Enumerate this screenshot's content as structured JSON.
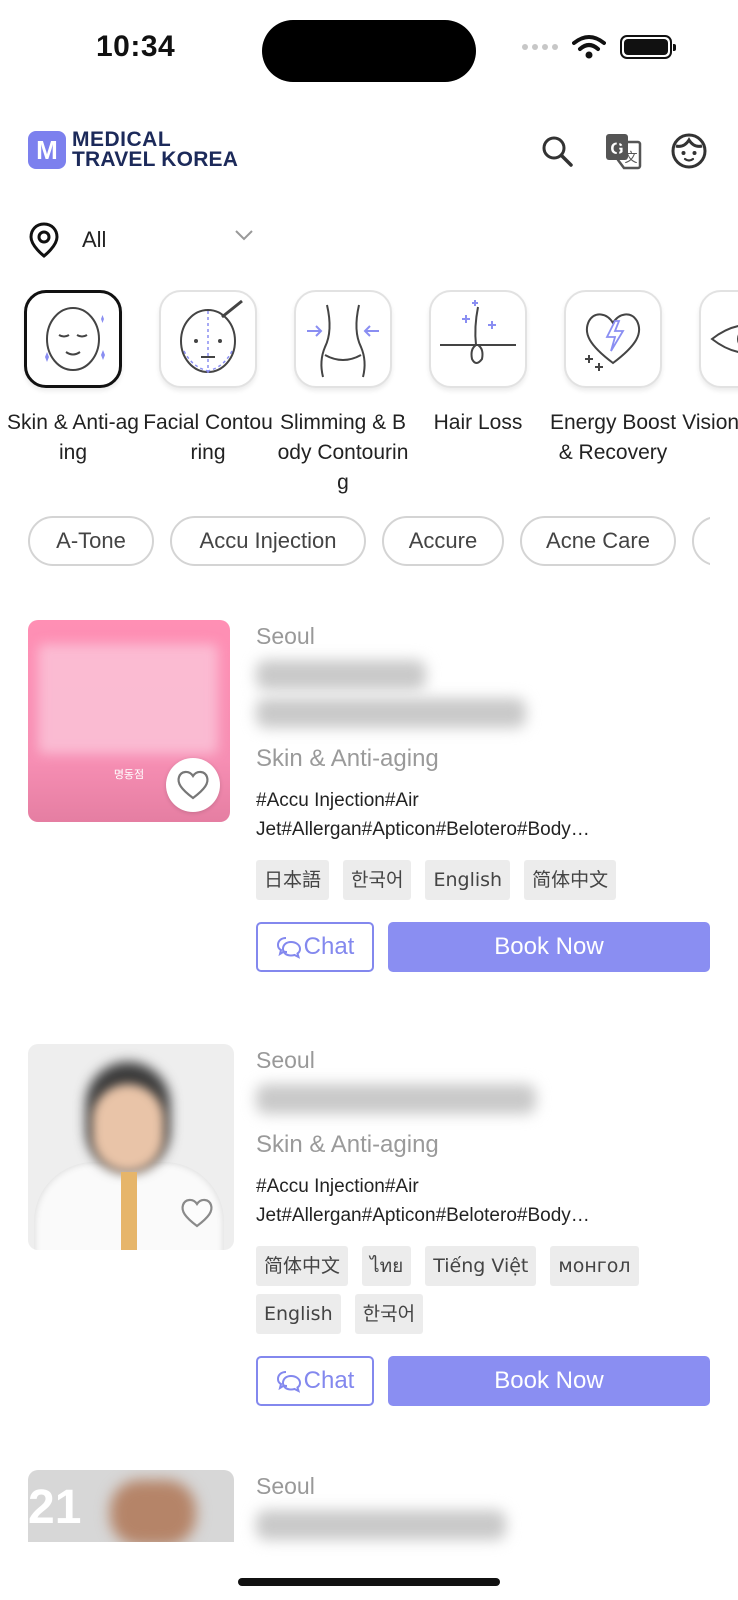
{
  "status_bar": {
    "time": "10:34"
  },
  "header": {
    "logo_letter": "M",
    "logo_line1": "MEDICAL",
    "logo_line2": "TRAVEL KOREA"
  },
  "location": {
    "value": "All"
  },
  "categories": [
    {
      "label": "Skin & Anti-aging",
      "icon": "face-sparkle-icon",
      "active": true
    },
    {
      "label": "Facial Contouring",
      "icon": "face-contour-icon",
      "active": false
    },
    {
      "label": "Slimming & Body Contouring",
      "icon": "waist-icon",
      "active": false
    },
    {
      "label": "Hair Loss",
      "icon": "hair-follicle-icon",
      "active": false
    },
    {
      "label": "Energy Boost & Recovery",
      "icon": "heart-bolt-icon",
      "active": false
    },
    {
      "label": "Vision Correct",
      "icon": "eye-icon",
      "active": false
    }
  ],
  "tags": [
    "A-Tone",
    "Accu Injection",
    "Accure",
    "Acne Care",
    ""
  ],
  "clinics": [
    {
      "city": "Seoul",
      "category": "Skin & Anti-aging",
      "thumb_caption": "명동점",
      "hashtags": "#Accu Injection#Air Jet#Allergan#Apticon#Belotero#Body…",
      "languages": [
        "日本語",
        "한국어",
        "English",
        "简体中文"
      ],
      "chat_label": "Chat",
      "book_label": "Book Now"
    },
    {
      "city": "Seoul",
      "category": "Skin & Anti-aging",
      "hashtags": "#Accu Injection#Air Jet#Allergan#Apticon#Belotero#Body…",
      "languages": [
        "简体中文",
        "ไทย",
        "Tiếng Việt",
        "монгол",
        "English",
        "한국어"
      ],
      "chat_label": "Chat",
      "book_label": "Book Now"
    },
    {
      "city": "Seoul",
      "thumb_number": "21"
    }
  ],
  "colors": {
    "accent": "#8a8ef2",
    "logo": "#7c80ee",
    "logo_text": "#1c2a5a"
  }
}
